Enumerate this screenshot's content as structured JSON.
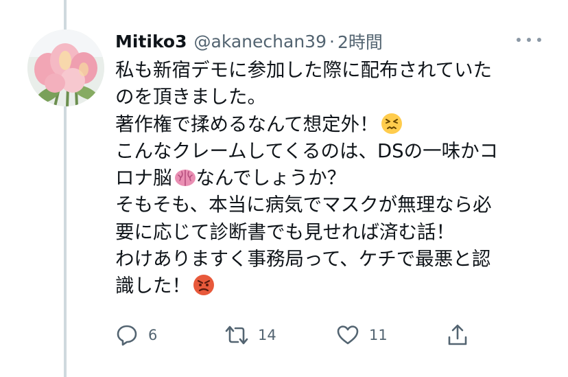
{
  "tweet": {
    "display_name": "Mitiko3",
    "handle": "@akanechan39",
    "separator": "·",
    "timestamp": "2時間",
    "body_lines": [
      "私も新宿デモに参加した際に配布されていた",
      "のを頂きました。",
      "著作権で揉めるなんて想定外！",
      "こんなクレームしてくるのは、DSの一味かコ",
      "ロナ脳",
      "なんでしょうか？",
      "そもそも、本当に病気でマスクが無理なら必",
      "要に応じて診断書でも見せれば済む話！",
      "わけありますく事務局って、ケチで最悪と認",
      "識した！"
    ],
    "emojis": [
      "persevering-face",
      "brain",
      "angry-face"
    ]
  },
  "actions": {
    "reply_count": "6",
    "retweet_count": "14",
    "like_count": "11"
  },
  "icons": {
    "reply": "reply-icon",
    "retweet": "retweet-icon",
    "like": "like-icon",
    "share": "share-icon",
    "more": "more-icon"
  },
  "colors": {
    "text": "#0f1419",
    "secondary": "#536471",
    "thread_line": "#cfd9de"
  }
}
